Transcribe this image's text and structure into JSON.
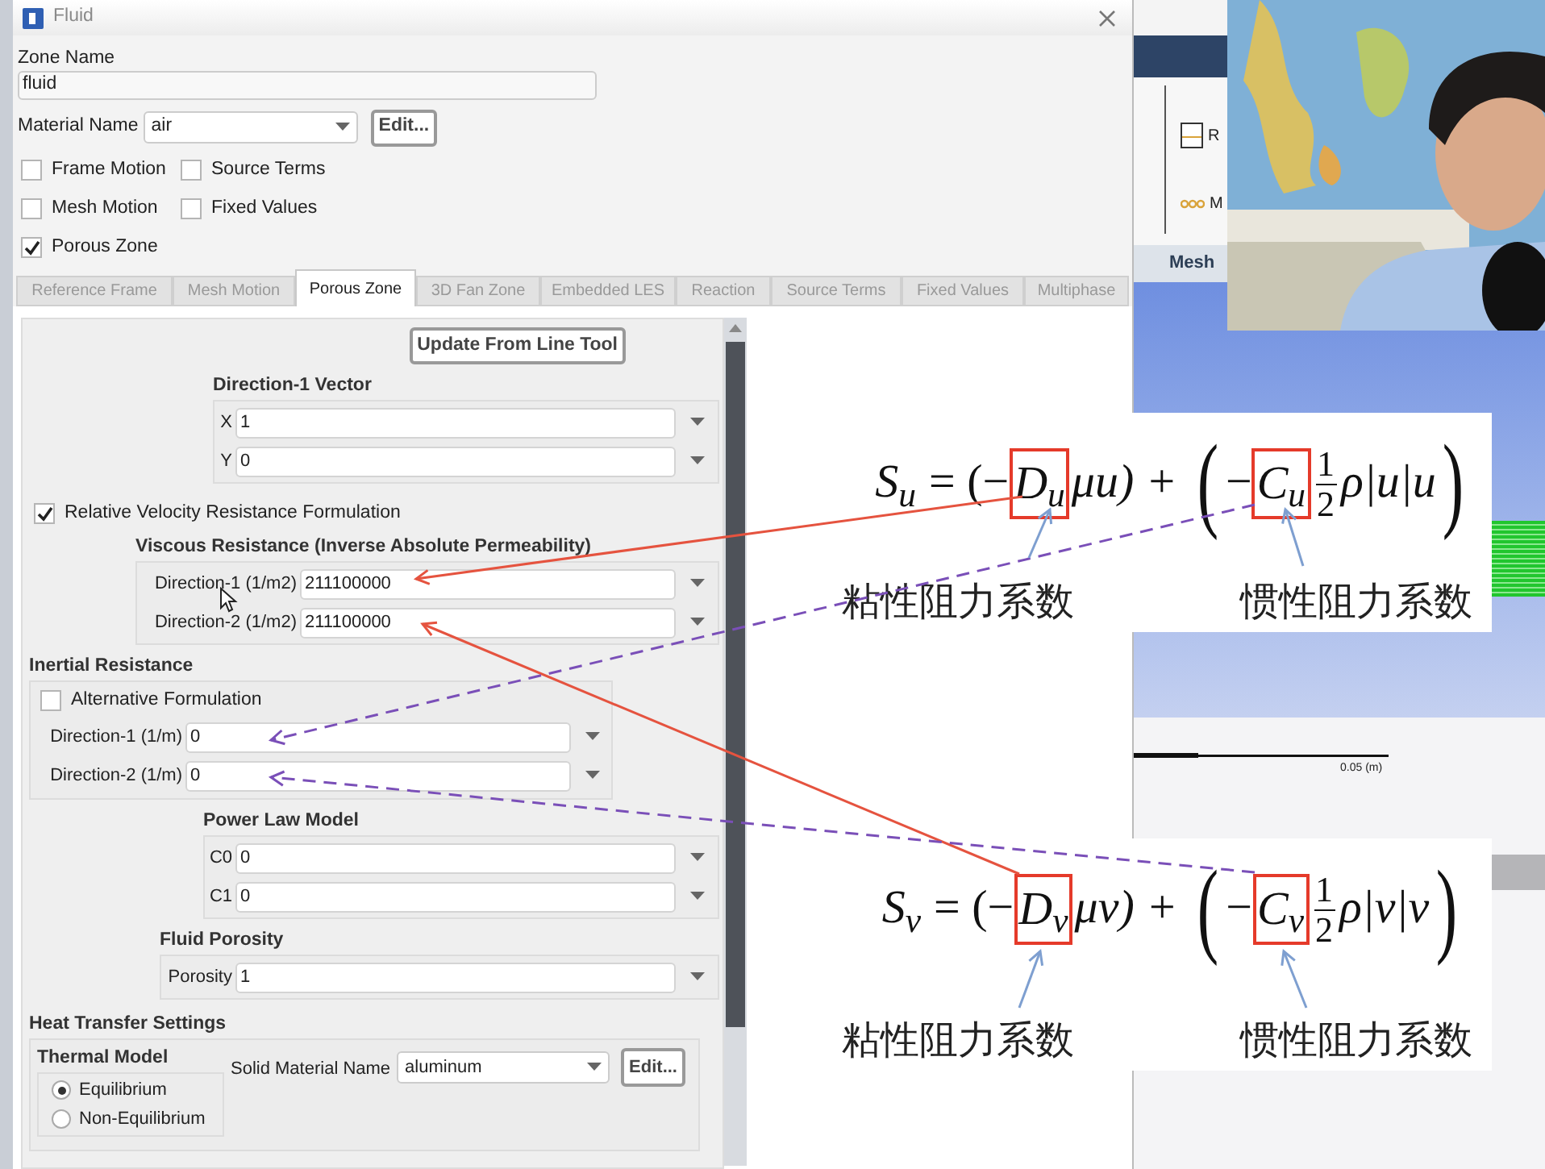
{
  "dialog": {
    "title": "Fluid",
    "zone_name_label": "Zone Name",
    "zone_name": "fluid",
    "material_label": "Material Name",
    "material": "air",
    "edit_button": "Edit...",
    "options": [
      {
        "label": "Frame Motion",
        "checked": false
      },
      {
        "label": "Source Terms",
        "checked": false
      },
      {
        "label": "Mesh Motion",
        "checked": false
      },
      {
        "label": "Fixed Values",
        "checked": false
      },
      {
        "label": "Porous Zone",
        "checked": true
      }
    ],
    "tabs": [
      {
        "label": "Reference Frame",
        "selected": false
      },
      {
        "label": "Mesh Motion",
        "selected": false
      },
      {
        "label": "Porous Zone",
        "selected": true
      },
      {
        "label": "3D Fan Zone",
        "selected": false
      },
      {
        "label": "Embedded LES",
        "selected": false
      },
      {
        "label": "Reaction",
        "selected": false
      },
      {
        "label": "Source Terms",
        "selected": false
      },
      {
        "label": "Fixed Values",
        "selected": false
      },
      {
        "label": "Multiphase",
        "selected": false
      }
    ],
    "porous_zone": {
      "update_button": "Update From Line Tool",
      "direction_vector": {
        "title": "Direction-1 Vector",
        "fields": [
          {
            "label": "X",
            "value": "1"
          },
          {
            "label": "Y",
            "value": "0"
          }
        ]
      },
      "relative_velocity": {
        "label": "Relative Velocity Resistance Formulation",
        "checked": true
      },
      "viscous": {
        "title": "Viscous Resistance (Inverse Absolute Permeability)",
        "fields": [
          {
            "label": "Direction-1 (1/m2)",
            "value": "211100000"
          },
          {
            "label": "Direction-2 (1/m2)",
            "value": "211100000"
          }
        ]
      },
      "inertial": {
        "title": "Inertial Resistance",
        "alternative": {
          "label": "Alternative Formulation",
          "checked": false
        },
        "fields": [
          {
            "label": "Direction-1 (1/m)",
            "value": "0"
          },
          {
            "label": "Direction-2 (1/m)",
            "value": "0"
          }
        ]
      },
      "power_law": {
        "title": "Power Law Model",
        "fields": [
          {
            "label": "C0",
            "value": "0"
          },
          {
            "label": "C1",
            "value": "0"
          }
        ]
      },
      "porosity": {
        "title": "Fluid Porosity",
        "fields": [
          {
            "label": "Porosity",
            "value": "1"
          }
        ]
      },
      "heat_transfer": {
        "title": "Heat Transfer Settings",
        "thermal_model": {
          "title": "Thermal Model",
          "options": [
            {
              "label": "Equilibrium",
              "selected": true
            },
            {
              "label": "Non-Equilibrium",
              "selected": false
            }
          ]
        },
        "solid_material_label": "Solid Material Name",
        "solid_material": "aluminum",
        "edit_button": "Edit..."
      }
    }
  },
  "background_app": {
    "ribbon_items": [
      "R",
      "M"
    ],
    "panel_title": "Mesh",
    "scale_label": "0.05 (m)"
  },
  "equations": [
    {
      "lhs": "S$_{u}$",
      "term1_open": "= (−",
      "viscous_coefficient": "D$_{u}$",
      "term1_rest": "μu) +",
      "big_open": "(",
      "term2_sign": "−",
      "inertial_coefficient": "C$_{u}$",
      "fraction": {
        "numerator": "1",
        "denominator": "2"
      },
      "term2_rest": "ρ|u|u",
      "big_close": ")",
      "labels": [
        "粘性阻力系数",
        "惯性阻力系数"
      ]
    },
    {
      "lhs": "S$_{v}$",
      "term1_open": "= (−",
      "viscous_coefficient": "D$_{v}$",
      "term1_rest": "μv) +",
      "big_open": "(",
      "term2_sign": "−",
      "inertial_coefficient": "C$_{v}$",
      "fraction": {
        "numerator": "1",
        "denominator": "2"
      },
      "term2_rest": "ρ|v|v",
      "big_close": ")",
      "labels": [
        "粘性阻力系数",
        "惯性阻力系数"
      ]
    }
  ]
}
